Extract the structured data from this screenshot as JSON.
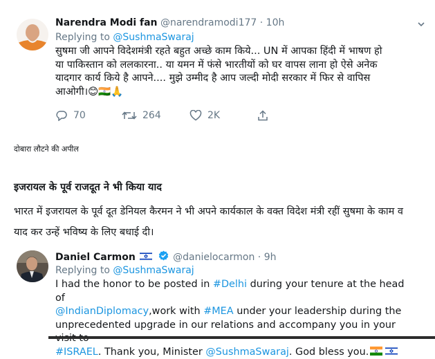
{
  "tweet1": {
    "display_name": "Narendra Modi fan",
    "handle": "@narendramodi177",
    "separator": "·",
    "time": "10h",
    "replying_prefix": "Replying to",
    "replying_to": "@SushmaSwaraj",
    "text_line1": "सुषमा जी आपने विदेशमंत्री रहते बहुत अच्छे काम किये... UN में आपका हिंदी में भाषण हो",
    "text_line2": "या पाकिस्तान को ललकारना..  या यमन में फंसे भारतीयों को घर वापस लाना हो ऐसे अनेक",
    "text_line3": "यादगार कार्य किये है आपने.... मुझे उम्मीद है आप जल्दी मोदी सरकार में फिर से वापिस",
    "text_line4": "आओगी।",
    "emoji": "😊🇮🇳🙏",
    "replies": "70",
    "retweets": "264",
    "likes": "2K"
  },
  "caption": "दोबारा लौटने की अपील",
  "heading": "इजरायल के पूर्व राजदूत ने भी किया याद",
  "paragraph_line1": "भारत में इजरायल के पूर्व दूत डेनियल कैरमन ने भी अपने कार्यकाल के वक्त विदेश मंत्री रहीं सुषमा के काम व",
  "paragraph_line2": "याद कर उन्हें भविष्य के लिए बधाई दी।",
  "tweet2": {
    "display_name": "Daniel Carmon",
    "flag": "🇮🇱",
    "handle": "@danielocarmon",
    "separator": "·",
    "time": "9h",
    "replying_prefix": "Replying to",
    "replying_to": "@SushmaSwaraj",
    "l1_a": "I had the honor to be posted in ",
    "l1_link": "#Delhi",
    "l1_b": " during your tenure at the head of",
    "l2_link1": "@IndianDiplomacy",
    "l2_a": ",work with ",
    "l2_link2": "#MEA",
    "l2_b": " under your leadership during the",
    "l3": "unprecedented upgrade in our relations and accompany you in your visit to",
    "l4_link1": "#ISRAEL",
    "l4_a": ". Thank you, Minister ",
    "l4_link2": "@SushmaSwaraj",
    "l4_b": ". God bless you."
  },
  "colors": {
    "link": "#1b95e0",
    "muted": "#657786",
    "verified": "#1da1f2"
  }
}
